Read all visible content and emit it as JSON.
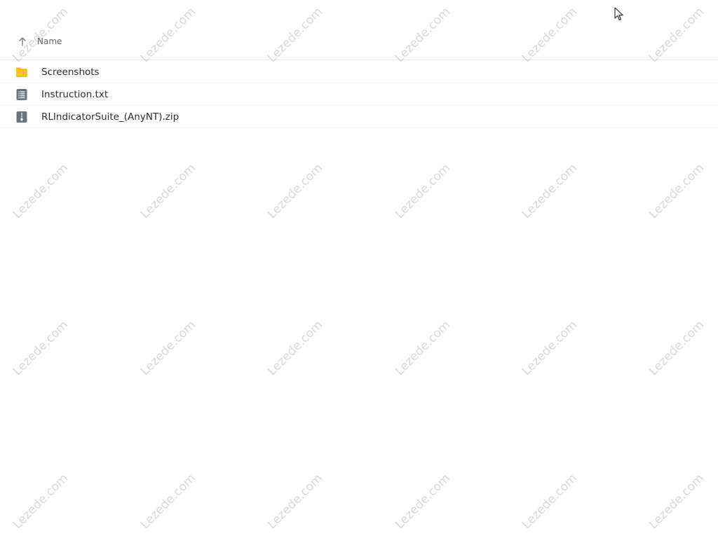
{
  "header": {
    "column_name": "Name",
    "sort_icon": "arrow-up-icon"
  },
  "files": [
    {
      "name": "Screenshots",
      "icon": "folder-icon",
      "icon_color": "#f8b51c"
    },
    {
      "name": "Instruction.txt",
      "icon": "text-file-icon",
      "icon_color": "#6b7280"
    },
    {
      "name": "RLIndicatorSuite_(AnyNT).zip",
      "icon": "zip-file-icon",
      "icon_color": "#6b7280"
    }
  ],
  "watermark": {
    "text": "Lezede.com"
  }
}
